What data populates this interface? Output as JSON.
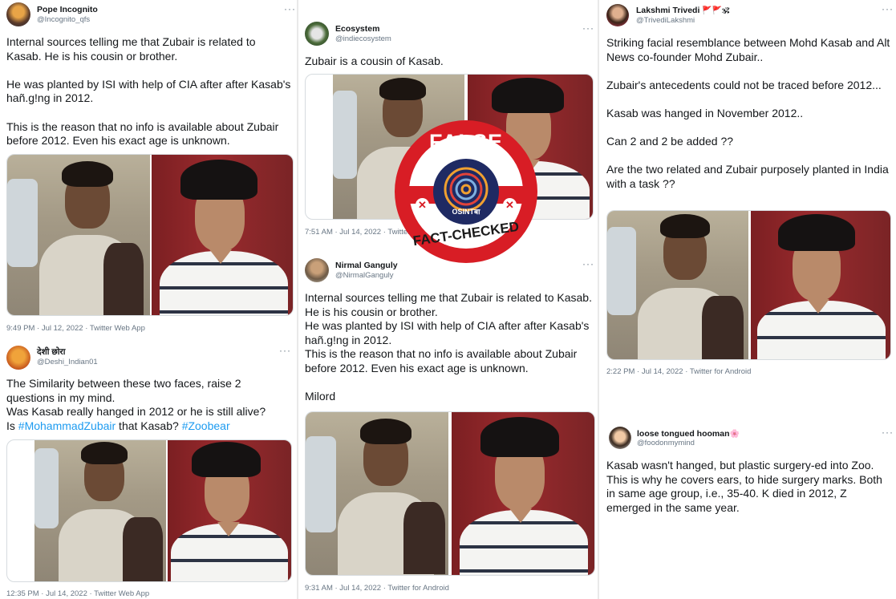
{
  "stamp": {
    "top_text": "FALSE NEWS",
    "brand": "OSINTबा",
    "bottom_text": "FACT-CHECKED",
    "accent": "#d81d25"
  },
  "tweets": [
    {
      "name": "Pope Incognito",
      "handle": "@Incognito_qfs",
      "more": "···",
      "body": "Internal sources telling me that Zubair is related to Kasab. He is his cousin or brother.\n\nHe was planted by ISI with help of CIA after after Kasab's hañ.g!ng in 2012.\n\nThis is the reason that no info is available about Zubair before 2012. Even his exact age is unknown.",
      "meta": "9:49 PM · Jul 12, 2022 · Twitter Web App"
    },
    {
      "name": "देशी छोरा",
      "handle": "@Deshi_Indian01",
      "more": "···",
      "body_pre": "The Similarity between these two faces, raise 2 questions in my mind.\nWas Kasab really hanged in 2012 or he is still alive?\nIs ",
      "hashtag1": "#MohammadZubair",
      "body_mid": " that Kasab? ",
      "hashtag2": "#Zoobear",
      "meta": "12:35 PM · Jul 14, 2022 · Twitter Web App"
    },
    {
      "name": "Ecosystem",
      "handle": "@indiecosystem",
      "more": "···",
      "body": "Zubair is a cousin of Kasab.",
      "meta": "7:51 AM · Jul 14, 2022 · Twitter"
    },
    {
      "name": "Nirmal Ganguly",
      "handle": "@NirmalGanguly",
      "more": "···",
      "body": "Internal sources telling me that Zubair is related to Kasab. He is his cousin or brother.\nHe was planted by ISI with help of CIA after after Kasab's hañ.g!ng in 2012.\nThis is the reason that no info is available about Zubair before 2012. Even his exact age is unknown.\n\nMilord",
      "meta": "9:31 AM · Jul 14, 2022 · Twitter for Android"
    },
    {
      "name": "Lakshmi Trivedi",
      "flags": "🚩🚩🕉",
      "handle": "@TrivediLakshmi",
      "more": "···",
      "body": "Striking facial resemblance between Mohd Kasab and Alt News co-founder Mohd Zubair..\n\nZubair's antecedents could not be traced before 2012...\n\nKasab was hanged in November 2012..\n\nCan 2 and 2 be added ??\n\nAre the two related and Zubair purposely planted in India with a  task ??",
      "meta": "2:22 PM · Jul 14, 2022 · Twitter for Android"
    },
    {
      "name": "loose tongued hooman",
      "flower": "🌸",
      "handle": "@foodonmymind",
      "more": "···",
      "body": "Kasab wasn't hanged, but plastic surgery-ed into Zoo. This is why he covers ears, to hide surgery marks. Both in same age group, i.e., 35-40. K died in 2012, Z emerged in the same year."
    }
  ]
}
